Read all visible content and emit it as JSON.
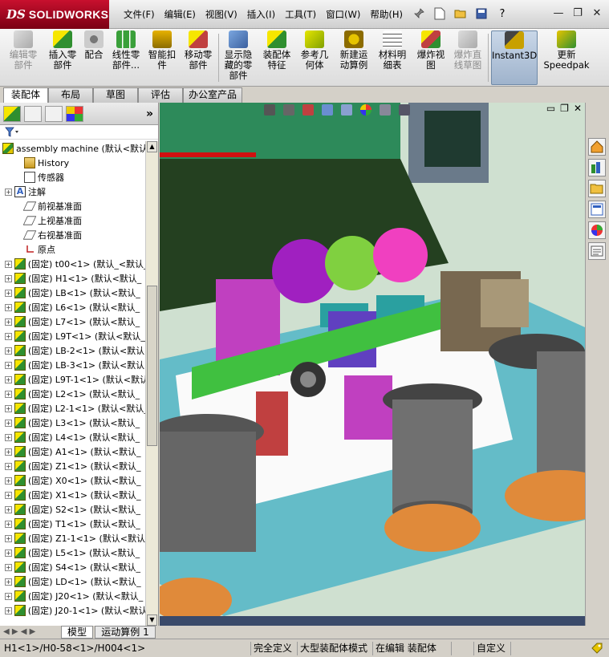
{
  "app": {
    "brand_prefix": "DS",
    "brand": "SOLIDWORKS"
  },
  "menu": [
    "文件(F)",
    "编辑(E)",
    "视图(V)",
    "插入(I)",
    "工具(T)",
    "窗口(W)",
    "帮助(H)"
  ],
  "quick_toolbar": {
    "pin_icon": "pin-icon",
    "new_icon": "new-document-icon",
    "open_icon": "open-folder-icon",
    "save_icon": "save-icon",
    "help_icon": "help-icon",
    "help_glyph": "?"
  },
  "window_controls": {
    "minimize": "—",
    "restore": "❐",
    "close": "✕"
  },
  "commands": [
    {
      "label": "编辑零\n部件",
      "icon": "edit-component-icon",
      "disabled": true
    },
    {
      "label": "插入零\n部件",
      "icon": "insert-component-icon",
      "disabled": false
    },
    {
      "label": "配合",
      "icon": "mate-icon",
      "disabled": false
    },
    {
      "label": "线性零\n部件...",
      "icon": "linear-pattern-icon",
      "disabled": false
    },
    {
      "label": "智能扣\n件",
      "icon": "smart-fasteners-icon",
      "disabled": false
    },
    {
      "label": "移动零\n部件",
      "icon": "move-component-icon",
      "disabled": false
    },
    {
      "label": "显示隐\n藏的零\n部件",
      "icon": "show-hidden-components-icon",
      "disabled": false
    },
    {
      "label": "装配体\n特征",
      "icon": "assembly-features-icon",
      "disabled": false
    },
    {
      "label": "参考几\n何体",
      "icon": "reference-geometry-icon",
      "disabled": false
    },
    {
      "label": "新建运\n动算例",
      "icon": "new-motion-study-icon",
      "disabled": false
    },
    {
      "label": "材料明\n细表",
      "icon": "bill-of-materials-icon",
      "disabled": false
    },
    {
      "label": "爆炸视\n图",
      "icon": "exploded-view-icon",
      "disabled": false
    },
    {
      "label": "爆炸直\n线草图",
      "icon": "explode-line-sketch-icon",
      "disabled": true
    },
    {
      "label": "Instant3D",
      "icon": "instant3d-icon",
      "disabled": false,
      "active": true
    },
    {
      "label": "更新\nSpeedpak",
      "icon": "update-speedpak-icon",
      "disabled": false
    }
  ],
  "tabs": [
    "装配体",
    "布局",
    "草图",
    "评估",
    "办公室产品"
  ],
  "active_tab": "装配体",
  "feature_tree": {
    "root": "assembly machine  (默认<默认_",
    "items": [
      {
        "label": "History",
        "icon": "history-folder-icon",
        "expand": false,
        "indent": 1
      },
      {
        "label": "传感器",
        "icon": "sensor-icon",
        "expand": false,
        "indent": 1
      },
      {
        "label": "注解",
        "icon": "annotations-icon",
        "expand": true,
        "indent": 0
      },
      {
        "label": "前视基准面",
        "icon": "plane-icon",
        "expand": false,
        "indent": 1
      },
      {
        "label": "上视基准面",
        "icon": "plane-icon",
        "expand": false,
        "indent": 1
      },
      {
        "label": "右视基准面",
        "icon": "plane-icon",
        "expand": false,
        "indent": 1
      },
      {
        "label": "原点",
        "icon": "origin-icon",
        "expand": false,
        "indent": 1
      },
      {
        "label": "(固定) t00<1> (默认_<默认_",
        "icon": "part-icon",
        "expand": true,
        "indent": 0
      },
      {
        "label": "(固定) H1<1> (默认<默认_",
        "icon": "part-icon",
        "expand": true,
        "indent": 0
      },
      {
        "label": "(固定) LB<1> (默认<默认_",
        "icon": "part-icon",
        "expand": true,
        "indent": 0
      },
      {
        "label": "(固定) L6<1> (默认<默认_",
        "icon": "part-icon",
        "expand": true,
        "indent": 0
      },
      {
        "label": "(固定) L7<1> (默认<默认_",
        "icon": "part-icon",
        "expand": true,
        "indent": 0
      },
      {
        "label": "(固定) L9T<1> (默认<默认_",
        "icon": "part-icon",
        "expand": true,
        "indent": 0
      },
      {
        "label": "(固定) LB-2<1> (默认<默认",
        "icon": "part-icon",
        "expand": true,
        "indent": 0
      },
      {
        "label": "(固定) LB-3<1> (默认<默认",
        "icon": "part-icon",
        "expand": true,
        "indent": 0
      },
      {
        "label": "(固定) L9T-1<1> (默认<默认",
        "icon": "part-icon",
        "expand": true,
        "indent": 0
      },
      {
        "label": "(固定) L2<1> (默认<默认_",
        "icon": "part-icon",
        "expand": true,
        "indent": 0
      },
      {
        "label": "(固定) L2-1<1> (默认<默认_",
        "icon": "part-icon",
        "expand": true,
        "indent": 0
      },
      {
        "label": "(固定) L3<1> (默认<默认_",
        "icon": "part-icon",
        "expand": true,
        "indent": 0
      },
      {
        "label": "(固定) L4<1> (默认<默认_",
        "icon": "part-icon",
        "expand": true,
        "indent": 0
      },
      {
        "label": "(固定) A1<1> (默认<默认_",
        "icon": "part-icon",
        "expand": true,
        "indent": 0
      },
      {
        "label": "(固定) Z1<1> (默认<默认_",
        "icon": "part-icon",
        "expand": true,
        "indent": 0
      },
      {
        "label": "(固定) X0<1> (默认<默认_",
        "icon": "part-icon",
        "expand": true,
        "indent": 0
      },
      {
        "label": "(固定) X1<1> (默认<默认_",
        "icon": "part-icon",
        "expand": true,
        "indent": 0
      },
      {
        "label": "(固定) S2<1> (默认<默认_",
        "icon": "part-icon",
        "expand": true,
        "indent": 0
      },
      {
        "label": "(固定) T1<1> (默认<默认_",
        "icon": "part-icon",
        "expand": true,
        "indent": 0
      },
      {
        "label": "(固定) Z1-1<1> (默认<默认",
        "icon": "part-icon",
        "expand": true,
        "indent": 0
      },
      {
        "label": "(固定) L5<1> (默认<默认_",
        "icon": "part-icon",
        "expand": true,
        "indent": 0
      },
      {
        "label": "(固定) S4<1> (默认<默认_",
        "icon": "part-icon",
        "expand": true,
        "indent": 0
      },
      {
        "label": "(固定) LD<1> (默认<默认_",
        "icon": "part-icon",
        "expand": true,
        "indent": 0
      },
      {
        "label": "(固定) J20<1> (默认<默认_",
        "icon": "part-icon",
        "expand": true,
        "indent": 0
      },
      {
        "label": "(固定) J20-1<1> (默认<默认_",
        "icon": "part-icon",
        "expand": true,
        "indent": 0
      }
    ]
  },
  "bottom_tabs": [
    "模型",
    "运动算例 1"
  ],
  "status": {
    "path": "H1<1>/H0-58<1>/H004<1>",
    "definition": "完全定义",
    "mode": "大型装配体模式",
    "editing": "在编辑 装配体",
    "units": "自定义"
  },
  "colors": {
    "brand_red": "#c8102e",
    "viewport_bg": "#c7d9c4",
    "panel_bg": "#d4d0c8"
  }
}
